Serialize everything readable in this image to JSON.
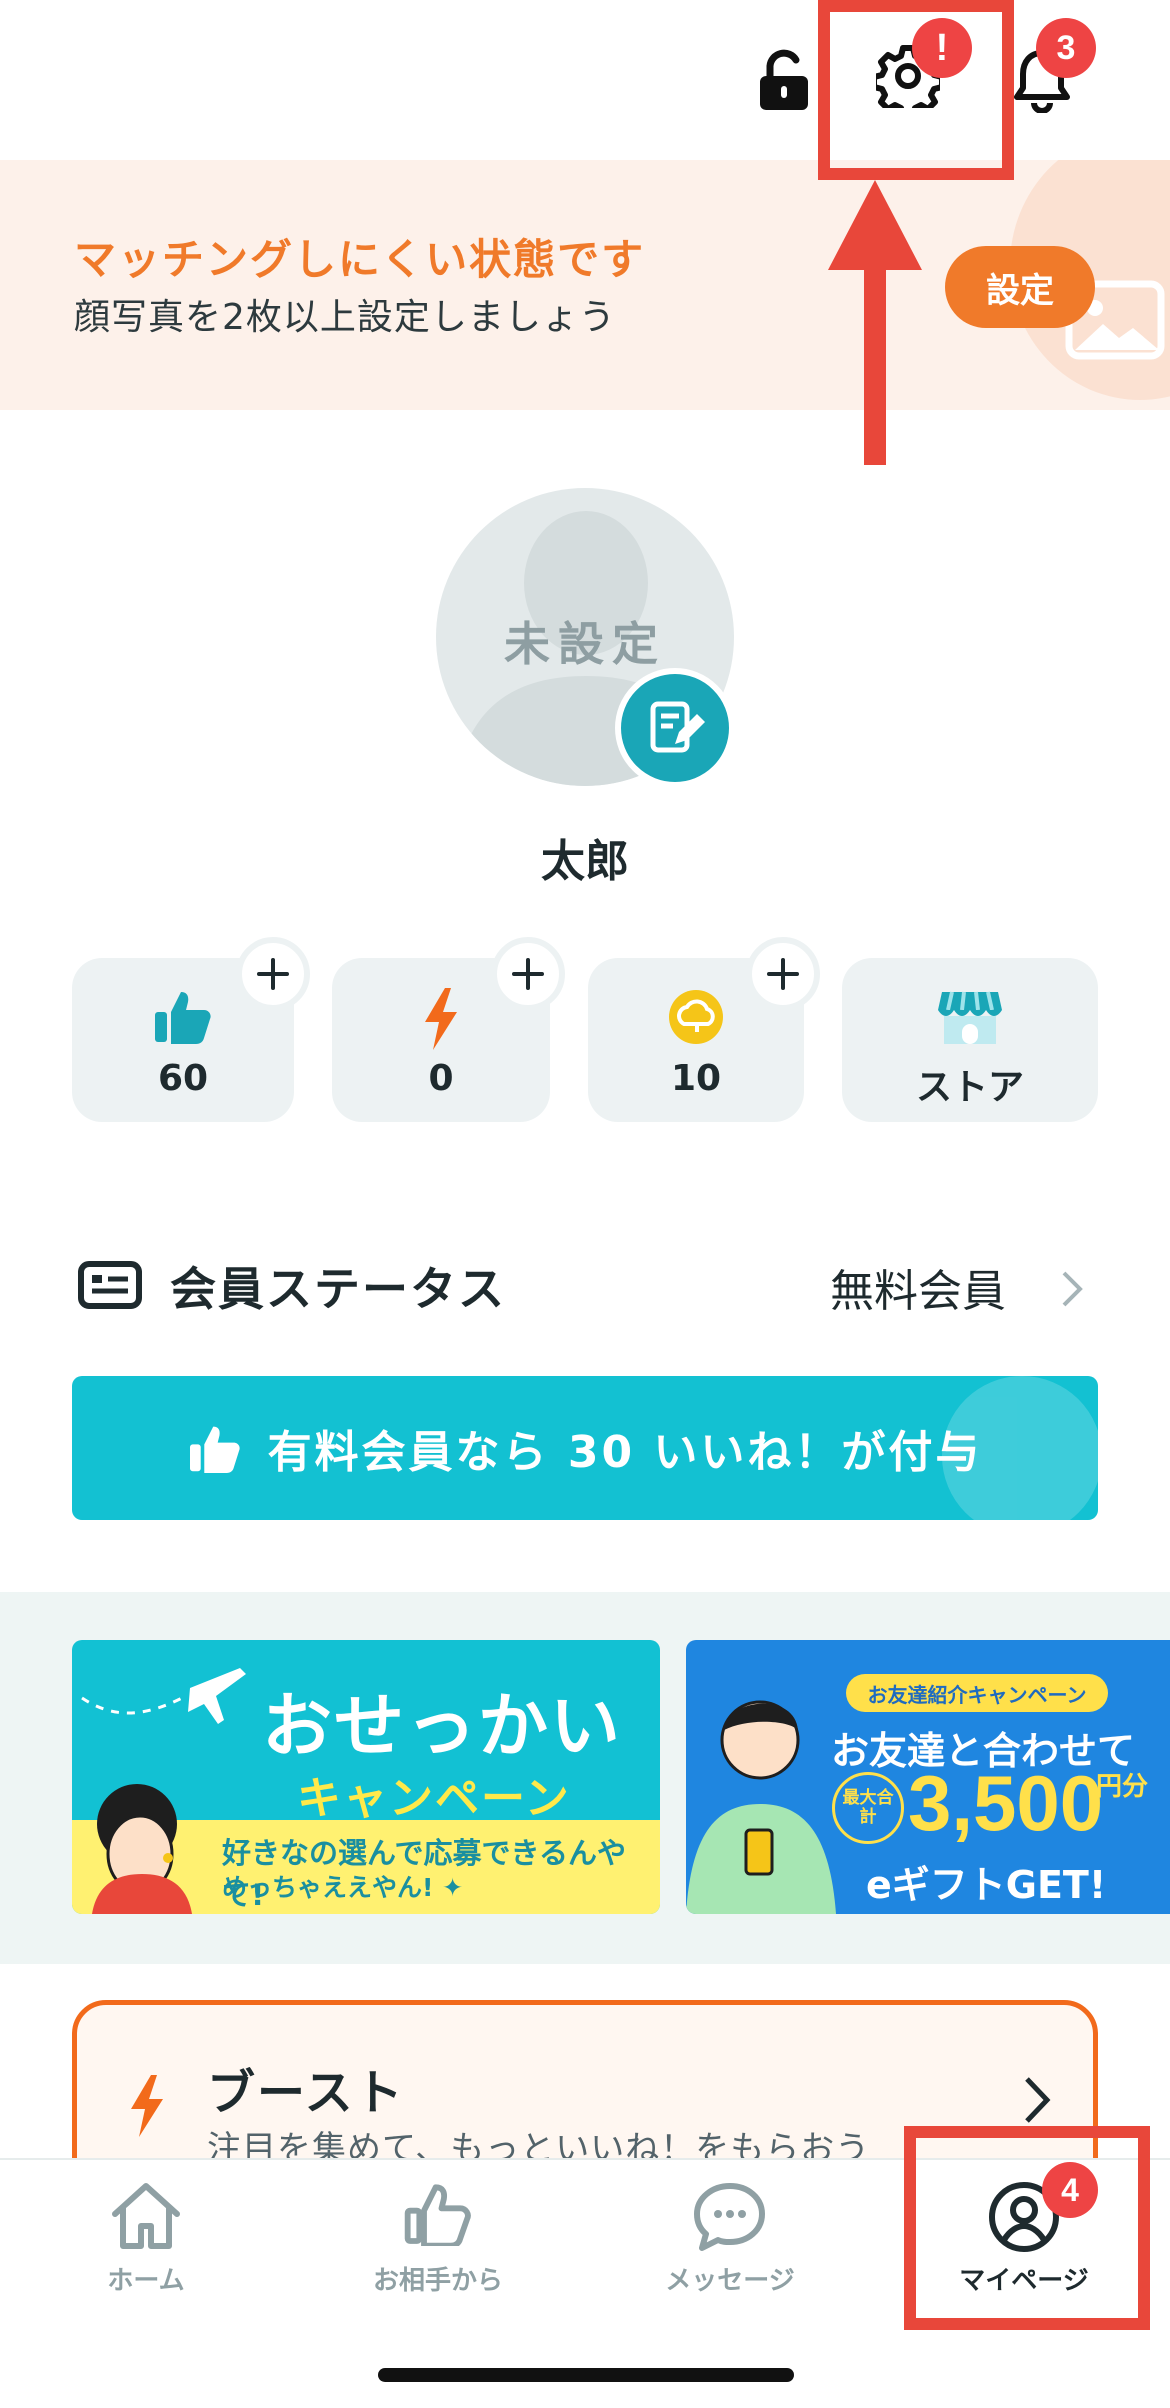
{
  "topbar": {
    "settings_badge": "!",
    "notifications_badge": "3"
  },
  "banner": {
    "title": "マッチングしにくい状態です",
    "subtitle": "顔写真を2枚以上設定しましょう",
    "button_label": "設定"
  },
  "profile": {
    "avatar_placeholder": "未設定",
    "name": "太郎"
  },
  "stats": [
    {
      "icon": "thumbs-up-icon",
      "value": "60"
    },
    {
      "icon": "lightning-icon",
      "value": "0"
    },
    {
      "icon": "coin-icon",
      "value": "10"
    },
    {
      "icon": "store-icon",
      "value": "ストア"
    }
  ],
  "membership": {
    "label": "会員ステータス",
    "value": "無料会員",
    "cta": "有料会員なら 30 いいね！が付与"
  },
  "campaigns": [
    {
      "title": "おせっかい",
      "subtitle": "キャンペーン",
      "line1": "好きなの選んで応募できるんやて!",
      "line2": "めっちゃええやん! ✦"
    },
    {
      "chip": "お友達紹介キャンペーン",
      "line1": "お友達と合わせて",
      "badge": "最大合計",
      "amount": "3,500",
      "unit": "円分",
      "line3": "eギフトGET!"
    }
  ],
  "boost": {
    "title": "ブースト",
    "subtitle": "注目を集めて、もっといいね！をもらおう"
  },
  "tabs": [
    {
      "label": "ホーム"
    },
    {
      "label": "お相手から"
    },
    {
      "label": "メッセージ"
    },
    {
      "label": "マイページ",
      "badge": "4"
    }
  ],
  "colors": {
    "accent": "#13c1d2",
    "warning": "#f07a2a",
    "highlight": "#e8473a"
  }
}
